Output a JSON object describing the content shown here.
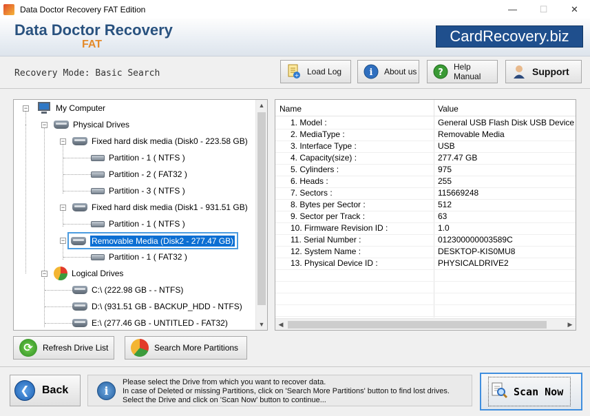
{
  "window": {
    "title": "Data Doctor Recovery FAT Edition",
    "minimize": "—",
    "maximize": "☐",
    "close": "✕"
  },
  "banner": {
    "brand_line1": "Data Doctor Recovery",
    "brand_line2": "FAT",
    "site": "CardRecovery.biz"
  },
  "mode_text": "Recovery Mode: Basic Search",
  "toolbar": {
    "load_log": "Load Log",
    "about_us": "About us",
    "help_manual": "Help Manual",
    "support": "Support"
  },
  "tree": {
    "root": "My Computer",
    "physical": "Physical Drives",
    "disk0": "Fixed hard disk media (Disk0 - 223.58 GB)",
    "disk0_parts": [
      "Partition - 1 ( NTFS )",
      "Partition - 2 ( FAT32 )",
      "Partition - 3 ( NTFS )"
    ],
    "disk1": "Fixed hard disk media (Disk1 - 931.51 GB)",
    "disk1_parts": [
      "Partition - 1 ( NTFS )"
    ],
    "disk2": "Removable Media (Disk2 - 277.47 GB)",
    "disk2_parts": [
      "Partition - 1 ( FAT32 )"
    ],
    "logical": "Logical Drives",
    "logical_items": [
      "C:\\ (222.98 GB -  - NTFS)",
      "D:\\ (931.51 GB - BACKUP_HDD - NTFS)",
      "E:\\ (277.46 GB - UNTITLED - FAT32)"
    ]
  },
  "properties": {
    "col_name": "Name",
    "col_value": "Value",
    "rows": [
      {
        "name": "1. Model :",
        "value": "General USB Flash Disk USB Device"
      },
      {
        "name": "2. MediaType :",
        "value": "Removable Media"
      },
      {
        "name": "3. Interface Type :",
        "value": "USB"
      },
      {
        "name": "4. Capacity(size) :",
        "value": "277.47 GB"
      },
      {
        "name": "5. Cylinders :",
        "value": "975"
      },
      {
        "name": "6. Heads :",
        "value": "255"
      },
      {
        "name": "7. Sectors :",
        "value": "115669248"
      },
      {
        "name": "8. Bytes per Sector :",
        "value": "512"
      },
      {
        "name": "9. Sector per Track :",
        "value": "63"
      },
      {
        "name": "10. Firmware Revision ID :",
        "value": "1.0"
      },
      {
        "name": "11. Serial Number :",
        "value": "012300000003589C"
      },
      {
        "name": "12. System Name :",
        "value": "DESKTOP-KIS0MU8"
      },
      {
        "name": "13. Physical Device ID :",
        "value": "PHYSICALDRIVE2"
      }
    ]
  },
  "buttons": {
    "refresh": "Refresh Drive List",
    "search_more": "Search More Partitions",
    "back": "Back",
    "scan_now": "Scan Now"
  },
  "info": {
    "line1": "Please select the Drive from which you want to recover data.",
    "line2": "In case of Deleted or missing Partitions, click on 'Search More Partitions' button to find lost drives.",
    "line3": "Select the Drive and click on 'Scan Now' button to continue..."
  },
  "colors": {
    "brand_blue": "#29527f",
    "brand_orange": "#e48a2a",
    "selection": "#0c6fd3"
  }
}
